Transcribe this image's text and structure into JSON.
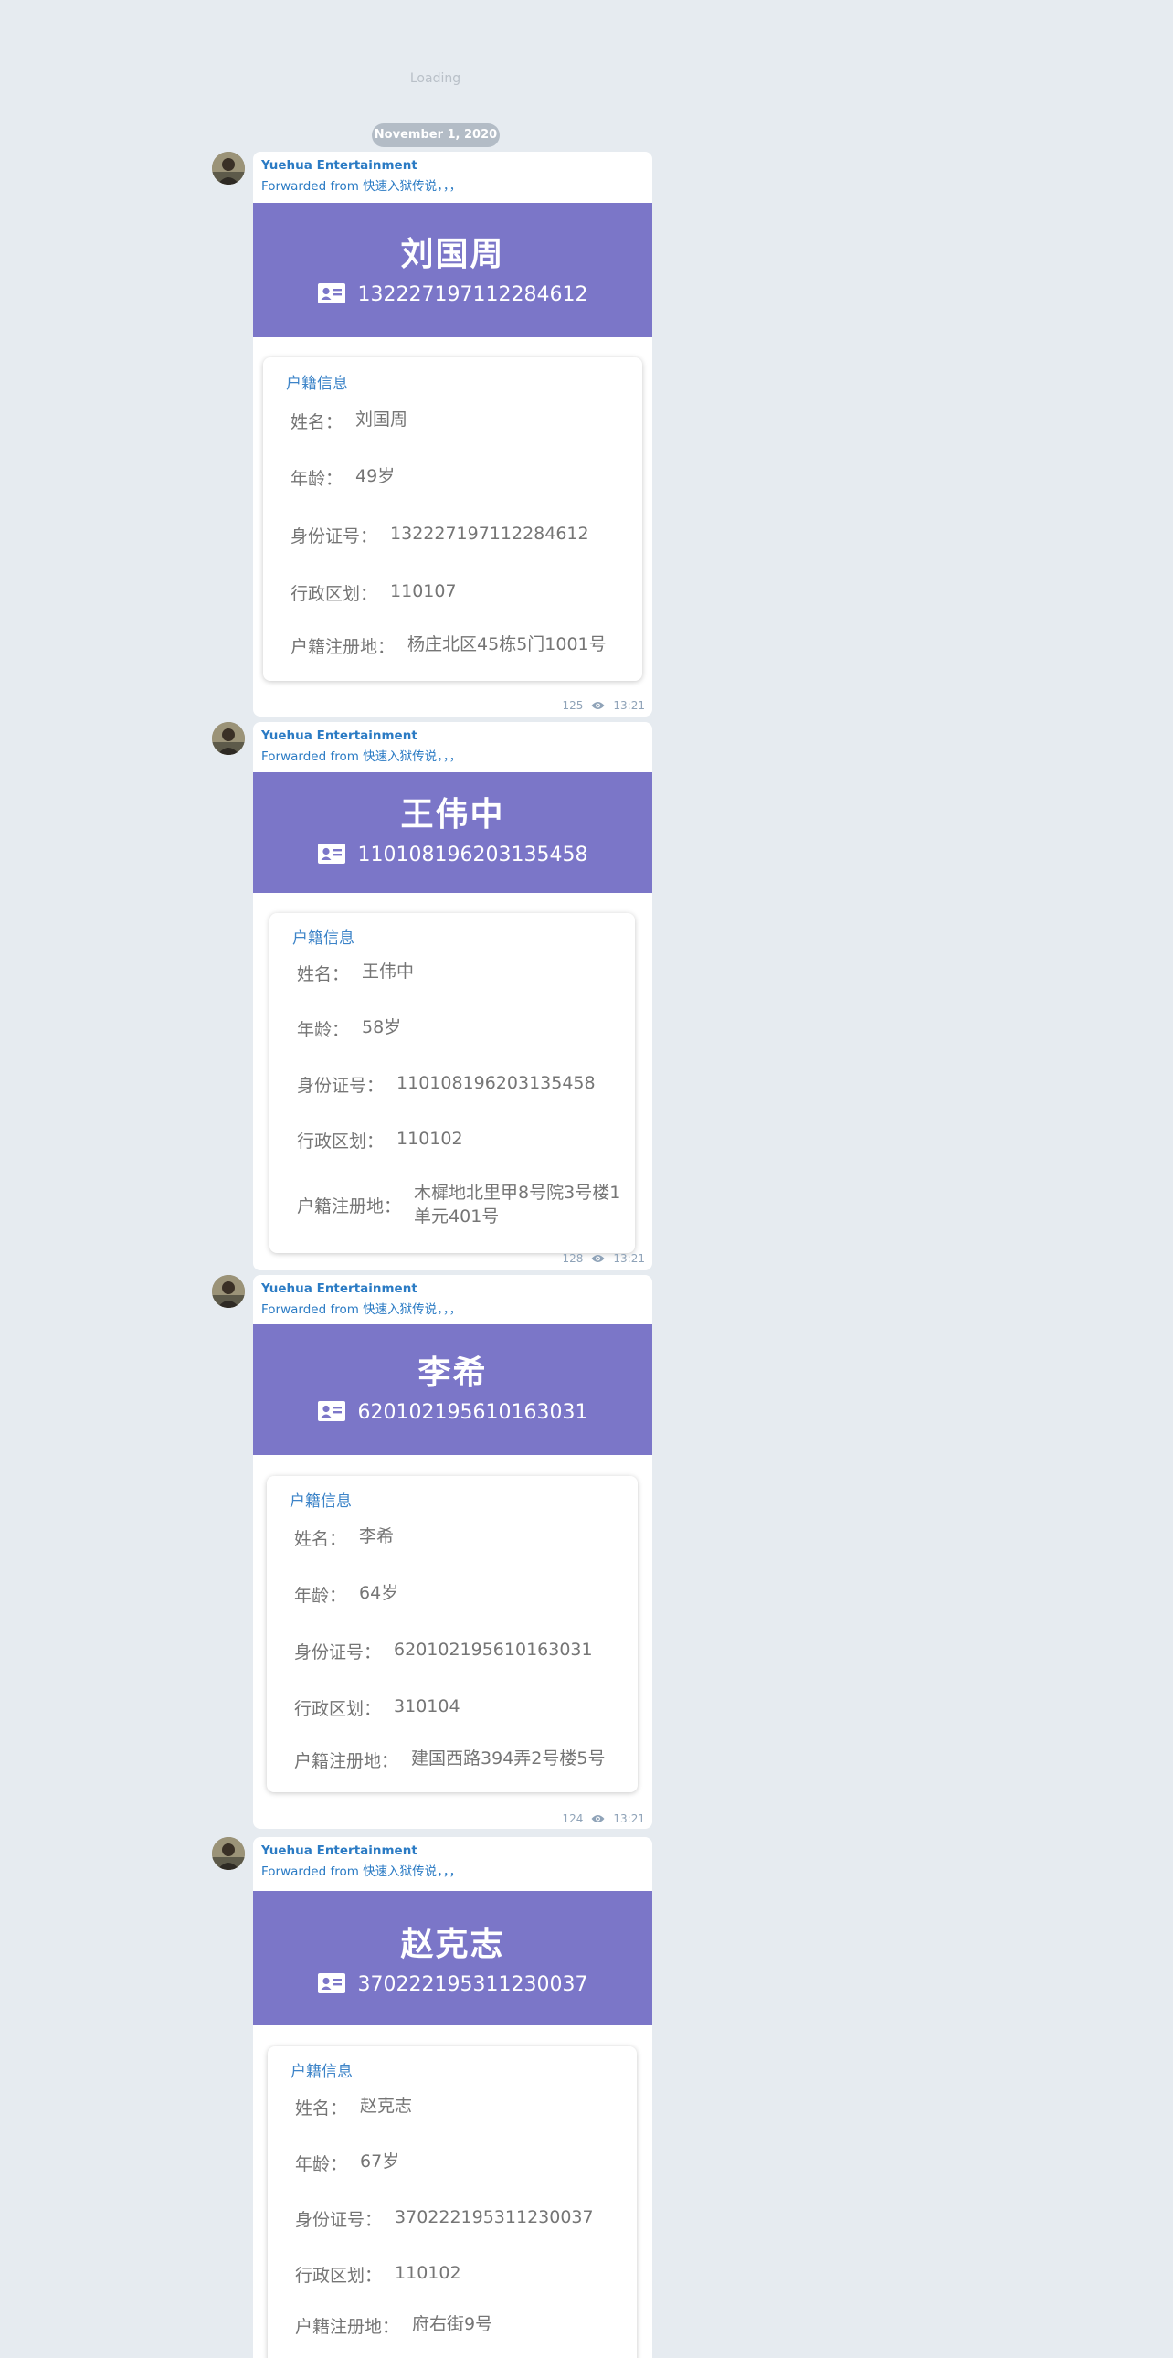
{
  "loading_text": "Loading",
  "date_label": "November 1, 2020",
  "messages": [
    {
      "sender": "Yuehua Entertainment",
      "forwarded_prefix": "Forwarded from ",
      "forwarded_source": "快速入狱传说，，，",
      "name": "刘国周",
      "id_number": "132227197112284612",
      "card_title": "户籍信息",
      "fields": [
        {
          "label": "姓名：",
          "value": "刘国周"
        },
        {
          "label": "年龄：",
          "value": "49岁"
        },
        {
          "label": "身份证号：",
          "value": "132227197112284612"
        },
        {
          "label": "行政区划：",
          "value": "110107"
        },
        {
          "label": "户籍注册地：",
          "value": "杨庄北区45栋5门1001号"
        }
      ],
      "views": "125",
      "time": "13:21"
    },
    {
      "sender": "Yuehua Entertainment",
      "forwarded_prefix": "Forwarded from ",
      "forwarded_source": "快速入狱传说，，，",
      "name": "王伟中",
      "id_number": "110108196203135458",
      "card_title": "户籍信息",
      "fields": [
        {
          "label": "姓名：",
          "value": "王伟中"
        },
        {
          "label": "年龄：",
          "value": "58岁"
        },
        {
          "label": "身份证号：",
          "value": "110108196203135458"
        },
        {
          "label": "行政区划：",
          "value": "110102"
        },
        {
          "label": "户籍注册地：",
          "value": "木樨地北里甲8号院3号楼1单元401号"
        }
      ],
      "views": "128",
      "time": "13:21"
    },
    {
      "sender": "Yuehua Entertainment",
      "forwarded_prefix": "Forwarded from ",
      "forwarded_source": "快速入狱传说，，，",
      "name": "李希",
      "id_number": "620102195610163031",
      "card_title": "户籍信息",
      "fields": [
        {
          "label": "姓名：",
          "value": "李希"
        },
        {
          "label": "年龄：",
          "value": "64岁"
        },
        {
          "label": "身份证号：",
          "value": "620102195610163031"
        },
        {
          "label": "行政区划：",
          "value": "310104"
        },
        {
          "label": "户籍注册地：",
          "value": "建国西路394弄2号楼5号"
        }
      ],
      "views": "124",
      "time": "13:21"
    },
    {
      "sender": "Yuehua Entertainment",
      "forwarded_prefix": "Forwarded from ",
      "forwarded_source": "快速入狱传说，，，",
      "name": "赵克志",
      "id_number": "370222195311230037",
      "card_title": "户籍信息",
      "fields": [
        {
          "label": "姓名：",
          "value": "赵克志"
        },
        {
          "label": "年龄：",
          "value": "67岁"
        },
        {
          "label": "身份证号：",
          "value": "370222195311230037"
        },
        {
          "label": "行政区划：",
          "value": "110102"
        },
        {
          "label": "户籍注册地：",
          "value": "府右街9号"
        }
      ]
    }
  ]
}
